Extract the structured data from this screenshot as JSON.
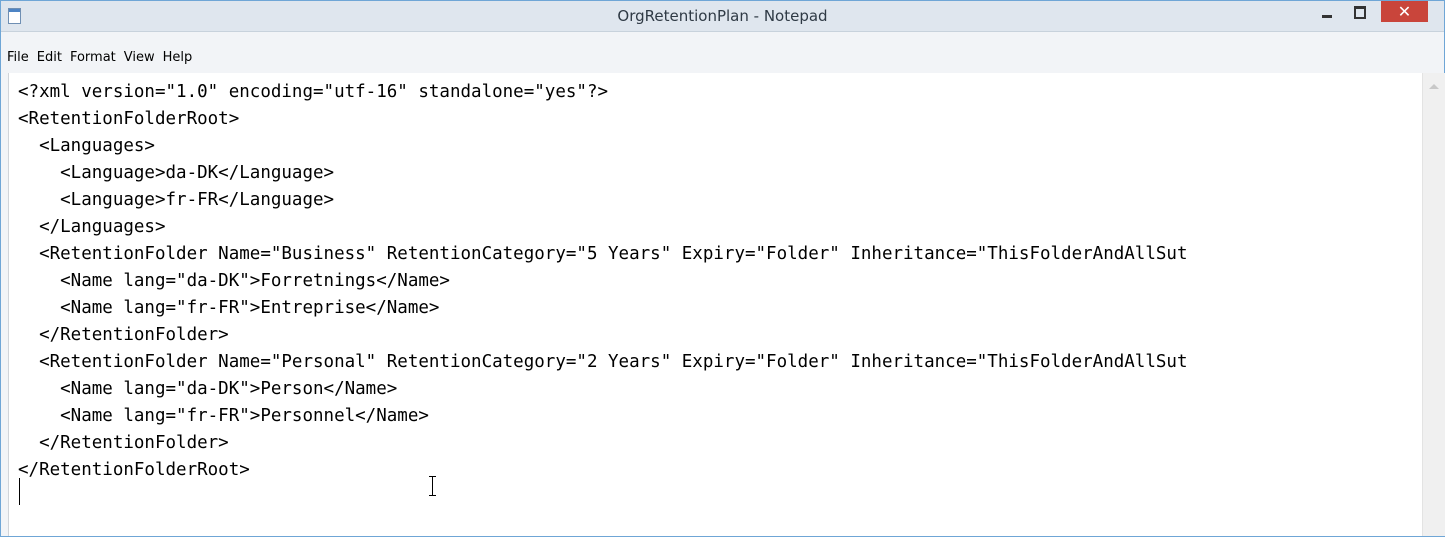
{
  "window": {
    "title": "OrgRetentionPlan - Notepad",
    "close_glyph": "✕"
  },
  "menu": {
    "items": [
      "File",
      "Edit",
      "Format",
      "View",
      "Help"
    ]
  },
  "editor": {
    "content": "<?xml version=\"1.0\" encoding=\"utf-16\" standalone=\"yes\"?>\n<RetentionFolderRoot>\n  <Languages>\n    <Language>da-DK</Language>\n    <Language>fr-FR</Language>\n  </Languages>\n  <RetentionFolder Name=\"Business\" RetentionCategory=\"5 Years\" Expiry=\"Folder\" Inheritance=\"ThisFolderAndAllSut\n    <Name lang=\"da-DK\">Forretnings</Name>\n    <Name lang=\"fr-FR\">Entreprise</Name>\n  </RetentionFolder>\n  <RetentionFolder Name=\"Personal\" RetentionCategory=\"2 Years\" Expiry=\"Folder\" Inheritance=\"ThisFolderAndAllSut\n    <Name lang=\"da-DK\">Person</Name>\n    <Name lang=\"fr-FR\">Personnel</Name>\n  </RetentionFolder>\n</RetentionFolderRoot>"
  },
  "colors": {
    "close_button": "#c9453b",
    "titlebar": "#dfe6ee",
    "window_border": "#6fa6d6"
  }
}
